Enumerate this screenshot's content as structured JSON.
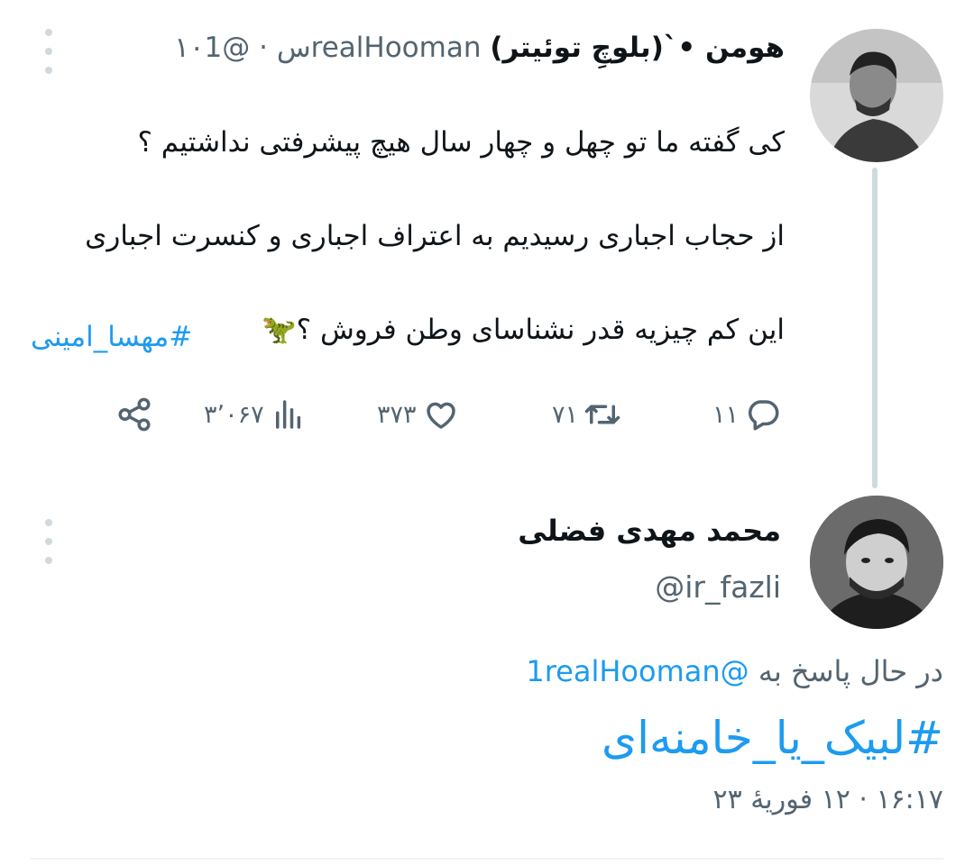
{
  "original_tweet": {
    "display_name": "هومن •`(بلوچِ توئیتر)",
    "handle": "@1realHooman",
    "separator": "·",
    "time_ago": "۱۰س",
    "text_lines": [
      "کی گفته ما تو چهل و چهار سال هیچ پیشرفتی نداشتیم ؟",
      "از حجاب اجباری رسیدیم به اعتراف اجباری و کنسرت اجباری",
      "این کم چیزیه قدر نشناسای وطن فروش ؟🦖"
    ],
    "hashtag": "#مهسا_امینی",
    "actions": {
      "replies": "۱۱",
      "retweets": "۷۱",
      "likes": "۳۷۳",
      "views": "۳٬۰۶۷"
    }
  },
  "reply": {
    "display_name": "محمد مهدی فضلی",
    "handle": "@ir_fazli",
    "replying_to_label": "در حال پاسخ به",
    "replying_to_handle": "@1realHooman",
    "hashtag": "#لبیک_یا_خامنه‌ای",
    "timestamp": "۱۶:۱۷ · ۱۲ فوریهٔ ۲۳"
  },
  "icons": {
    "reply": "reply-icon",
    "retweet": "retweet-icon",
    "like": "heart-icon",
    "views": "views-icon",
    "share": "share-icon",
    "more": "more-icon"
  },
  "colors": {
    "accent": "#1d9bf0",
    "secondary_text": "#536471",
    "thread_line": "#cfd9de"
  }
}
